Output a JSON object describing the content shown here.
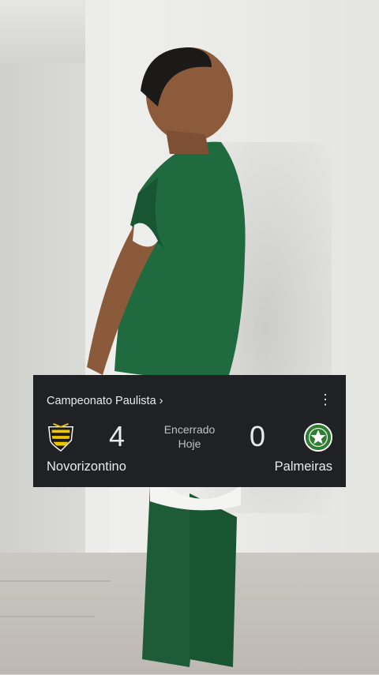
{
  "scorecard": {
    "competition": "Campeonato Paulista ›",
    "menu_icon": "more-vert-icon",
    "home": {
      "name": "Novorizontino",
      "score": "4",
      "logo": "novorizontino-crest-icon"
    },
    "away": {
      "name": "Palmeiras",
      "score": "0",
      "logo": "palmeiras-crest-icon"
    },
    "status_line1": "Encerrado",
    "status_line2": "Hoje"
  },
  "colors": {
    "card_bg": "#202124",
    "jersey_green": "#1b5e3a",
    "novorizontino_yellow": "#f2c400",
    "palmeiras_green": "#2e7d32"
  }
}
